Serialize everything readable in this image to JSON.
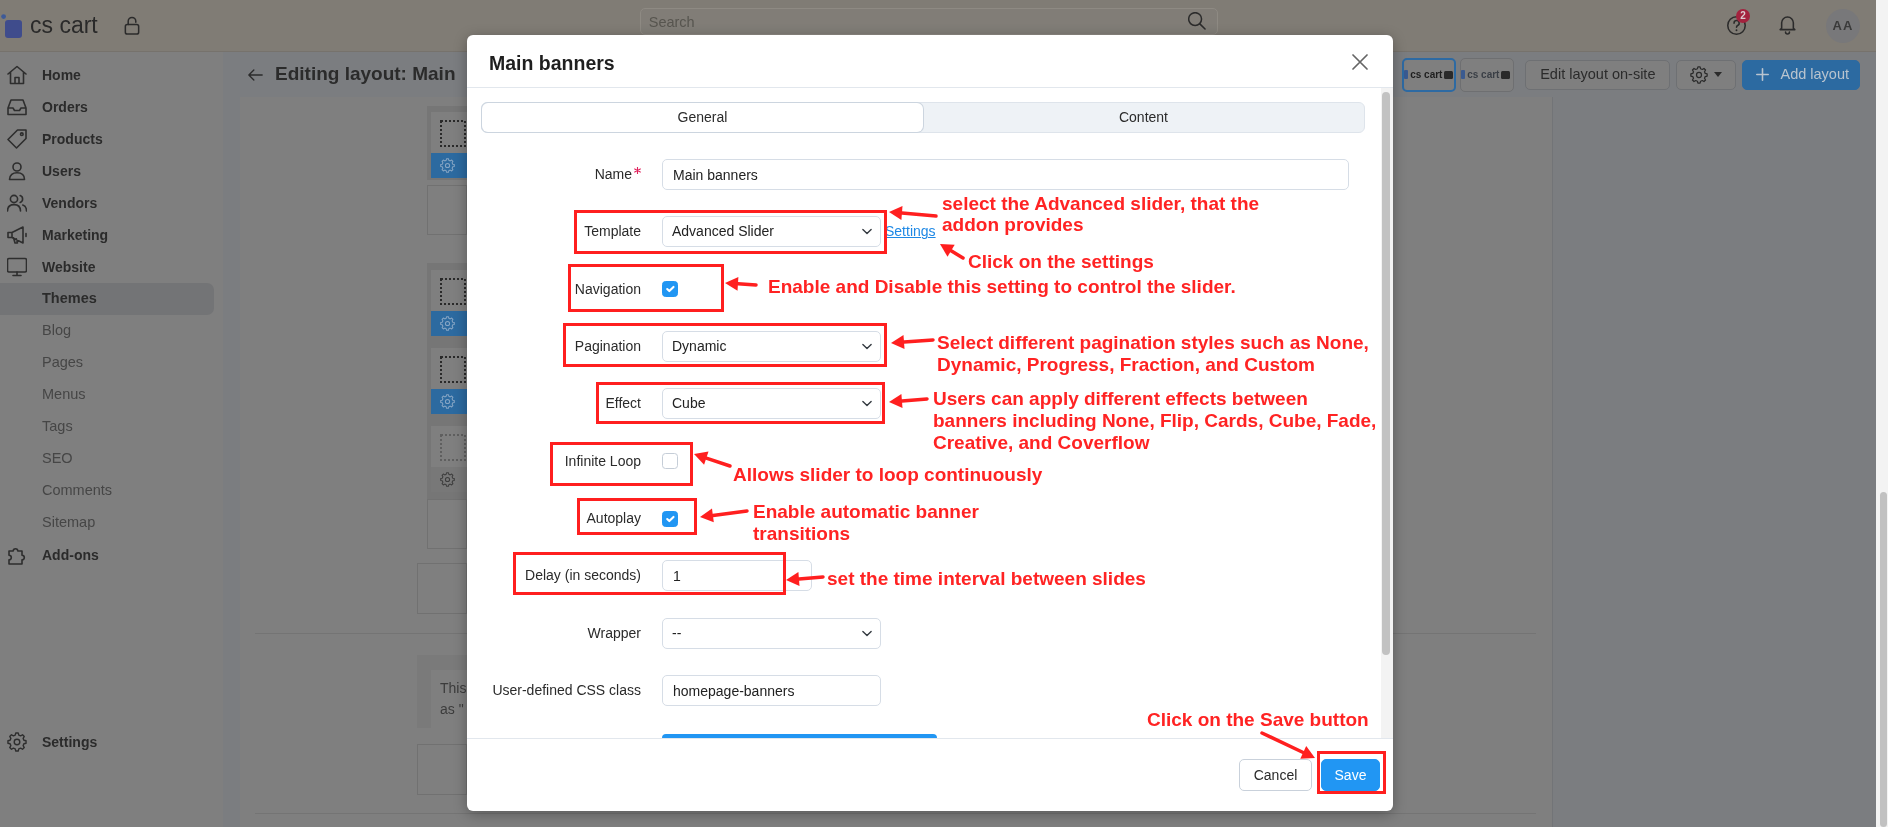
{
  "topbar": {
    "logo": "cs cart",
    "search": {
      "placeholder": "Search"
    },
    "help_badge": "2",
    "avatar": "AA"
  },
  "sidebar": {
    "items": [
      {
        "label": "Home",
        "selected": false
      },
      {
        "label": "Orders",
        "selected": false
      },
      {
        "label": "Products",
        "selected": false
      },
      {
        "label": "Users",
        "selected": false
      },
      {
        "label": "Vendors",
        "selected": false
      },
      {
        "label": "Marketing",
        "selected": false
      },
      {
        "label": "Website",
        "selected": false,
        "children": [
          {
            "label": "Themes",
            "selected": true
          },
          {
            "label": "Blog",
            "selected": false
          },
          {
            "label": "Pages",
            "selected": false
          },
          {
            "label": "Menus",
            "selected": false
          },
          {
            "label": "Tags",
            "selected": false
          },
          {
            "label": "SEO",
            "selected": false
          },
          {
            "label": "Comments",
            "selected": false
          },
          {
            "label": "Sitemap",
            "selected": false
          }
        ]
      },
      {
        "label": "Add-ons",
        "selected": false
      }
    ],
    "bottom_item": {
      "label": "Settings"
    }
  },
  "page": {
    "title": "Editing layout: Main",
    "theme_previews": [
      {
        "label": "cs cart",
        "selected": true
      },
      {
        "label": "cs cart",
        "selected": false
      }
    ],
    "actions": [
      {
        "kind": "outline",
        "label": "Edit layout on-site"
      },
      {
        "kind": "settings_menu"
      },
      {
        "kind": "primary",
        "label": "Add layout"
      }
    ],
    "layout_groups": [
      {
        "blocks": [
          {
            "enabled": true
          }
        ]
      },
      {
        "blocks": [
          {
            "enabled": true
          },
          {
            "enabled": true
          },
          {
            "enabled": false
          }
        ]
      }
    ],
    "note_lines": [
      "This",
      "as \""
    ]
  },
  "modal": {
    "title": "Main banners",
    "tabs": [
      {
        "label": "General",
        "selected": true
      },
      {
        "label": "Content",
        "selected": false
      }
    ],
    "fields": [
      {
        "kind": "text",
        "label": "Name",
        "required": true,
        "value": "Main banners",
        "highlighted": false
      },
      {
        "kind": "select",
        "label": "Template",
        "required": false,
        "value": "Advanced Slider",
        "link": "Settings",
        "highlighted": true
      },
      {
        "kind": "checkbox",
        "label": "Navigation",
        "required": false,
        "checked": true,
        "highlighted": true
      },
      {
        "kind": "select",
        "label": "Pagination",
        "required": false,
        "value": "Dynamic",
        "highlighted": true
      },
      {
        "kind": "select",
        "label": "Effect",
        "required": false,
        "value": "Cube",
        "highlighted": true
      },
      {
        "kind": "checkbox",
        "label": "Infinite Loop",
        "required": false,
        "checked": false,
        "highlighted": true
      },
      {
        "kind": "checkbox",
        "label": "Autoplay",
        "required": false,
        "checked": true,
        "highlighted": true
      },
      {
        "kind": "text",
        "label": "Delay (in seconds)",
        "required": false,
        "value": "1",
        "highlighted": true
      },
      {
        "kind": "select",
        "label": "Wrapper",
        "required": false,
        "value": "--",
        "highlighted": false
      },
      {
        "kind": "text",
        "label": "User-defined CSS class",
        "required": false,
        "value": "homepage-banners",
        "highlighted": false
      }
    ],
    "buttons": [
      {
        "kind": "secondary",
        "label": "Cancel",
        "highlighted": false
      },
      {
        "kind": "primary",
        "label": "Save",
        "highlighted": true
      }
    ],
    "annotations": [
      {
        "text": "select the Advanced slider, that the\naddon provides"
      },
      {
        "text": "Click on the settings"
      },
      {
        "text": "Enable and Disable this setting to control the slider."
      },
      {
        "text": "Select different pagination styles such as None,\nDynamic, Progress, Fraction, and Custom"
      },
      {
        "text": "Users can apply different effects between\nbanners including None, Flip, Cards, Cube, Fade,\nCreative, and Coverflow"
      },
      {
        "text": "Allows slider to loop continuously"
      },
      {
        "text": "Enable automatic banner\ntransitions"
      },
      {
        "text": "set the time interval between slides"
      },
      {
        "text": "Click on the Save button"
      }
    ]
  }
}
